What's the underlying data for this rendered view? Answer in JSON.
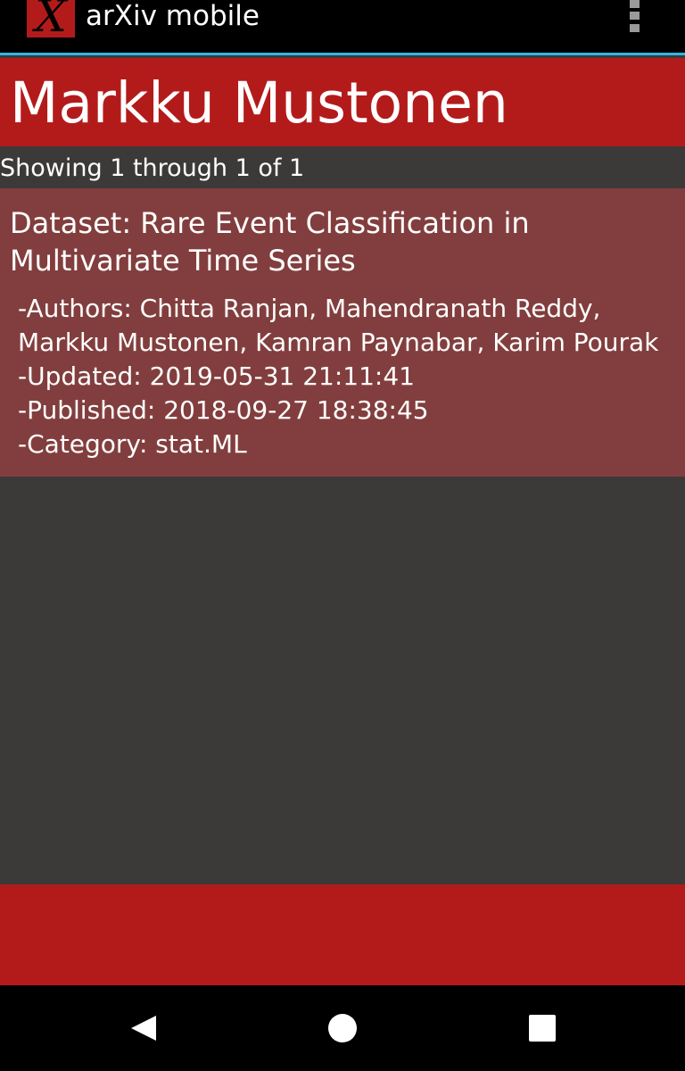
{
  "app": {
    "logo_glyph": "X",
    "title": "arXiv mobile"
  },
  "header": {
    "title": "Markku Mustonen"
  },
  "results": {
    "showing_text": "Showing 1 through 1 of 1",
    "items": [
      {
        "title": "Dataset: Rare Event Classification in Multivariate Time Series",
        "authors_line": "-Authors: Chitta Ranjan, Mahendranath Reddy, Markku Mustonen, Kamran Paynabar, Karim Pourak",
        "updated_line": "-Updated: 2019-05-31 21:11:41",
        "published_line": "-Published: 2018-09-27 18:38:45",
        "category_line": "-Category: stat.ML"
      }
    ]
  },
  "icons": {
    "overflow": "more-vert-icon",
    "back": "back-triangle-icon",
    "home": "home-circle-icon",
    "recents": "recents-square-icon"
  },
  "colors": {
    "brand_red": "#b31b1b",
    "item_background": "#823e3e",
    "page_background": "#3b3a39",
    "accent_divider": "#33b5e5"
  }
}
